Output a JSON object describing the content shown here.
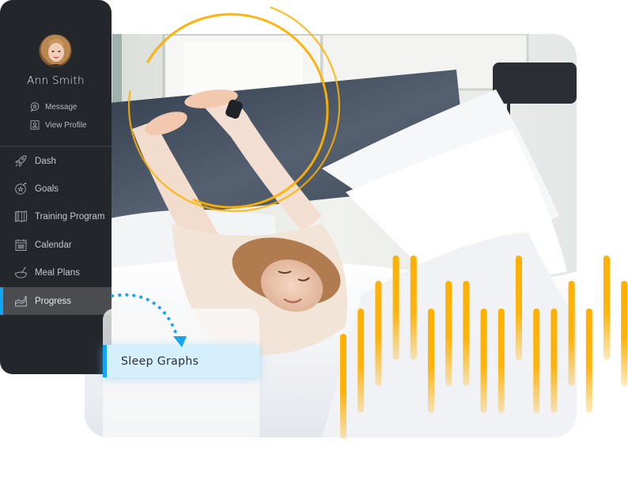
{
  "user": {
    "name": "Ann Smith",
    "links": [
      {
        "label": "Message",
        "icon": "chat-star-icon"
      },
      {
        "label": "View Profile",
        "icon": "profile-card-icon"
      }
    ]
  },
  "nav": {
    "items": [
      {
        "label": "Dash",
        "icon": "rocket-icon",
        "active": false
      },
      {
        "label": "Goals",
        "icon": "target-icon",
        "active": false
      },
      {
        "label": "Training Program",
        "icon": "map-icon",
        "active": false
      },
      {
        "label": "Calendar",
        "icon": "calendar-icon",
        "active": false
      },
      {
        "label": "Meal Plans",
        "icon": "bowl-icon",
        "active": false
      },
      {
        "label": "Progress",
        "icon": "chart-icon",
        "active": true
      }
    ]
  },
  "submenu": {
    "items": [
      {
        "label": "Sleep Graphs",
        "active": true
      }
    ]
  },
  "colors": {
    "sidebar_bg": "#23262b",
    "accent_blue": "#12a6f1",
    "accent_yellow": "#ffb000",
    "highlight_bg": "#d6effd"
  },
  "decor": {
    "sound_wave_levels": [
      1,
      2,
      3,
      4,
      4,
      2,
      3,
      3,
      2,
      2,
      4,
      2,
      2,
      3,
      2,
      4,
      3
    ]
  }
}
